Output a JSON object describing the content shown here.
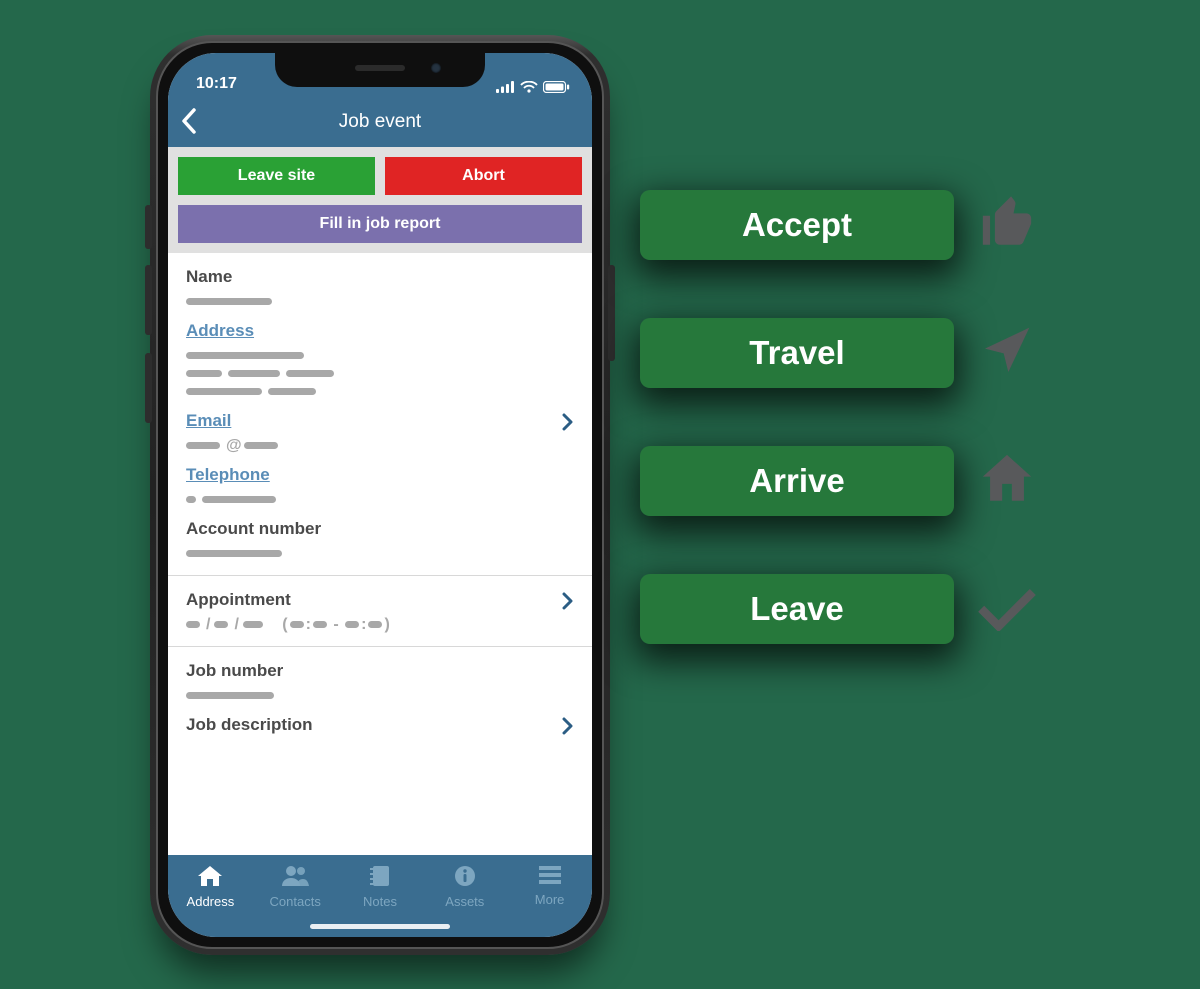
{
  "statusbar": {
    "time": "10:17"
  },
  "header": {
    "title": "Job event"
  },
  "actions": {
    "leave_site": "Leave site",
    "abort": "Abort",
    "fill_report": "Fill in job report"
  },
  "fields": {
    "name": "Name",
    "address": "Address",
    "email": "Email",
    "telephone": "Telephone",
    "account_number": "Account number",
    "appointment": "Appointment",
    "job_number": "Job number",
    "job_description": "Job description"
  },
  "tabs": {
    "address": "Address",
    "contacts": "Contacts",
    "notes": "Notes",
    "assets": "Assets",
    "more": "More"
  },
  "side_buttons": {
    "accept": "Accept",
    "travel": "Travel",
    "arrive": "Arrive",
    "leave": "Leave"
  },
  "icons": {
    "back": "back-chevron-icon",
    "signal": "cellular-signal-icon",
    "wifi": "wifi-icon",
    "battery": "battery-icon",
    "chevron": "chevron-right-icon",
    "home": "home-icon",
    "contacts": "people-icon",
    "notes": "notebook-icon",
    "info": "info-icon",
    "more": "hamburger-icon",
    "thumbs": "thumbs-up-icon",
    "navarrow": "location-arrow-icon",
    "house": "house-icon",
    "check": "check-icon"
  }
}
